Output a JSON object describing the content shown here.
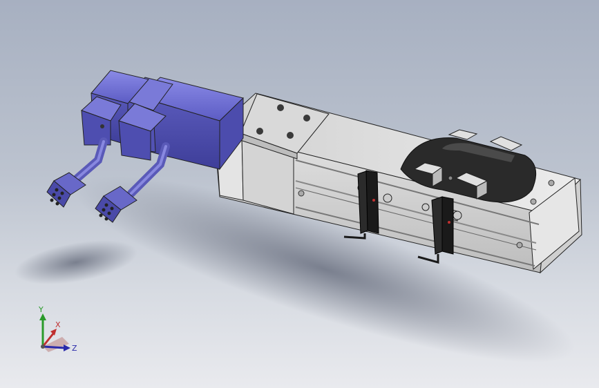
{
  "viewport": {
    "background_top": "#a7b0c1",
    "background_bottom": "#e9eaee"
  },
  "model": {
    "motor_color": "#6767cc",
    "body_color": "#dcdcdc",
    "sensor_color": "#1a1a1a"
  },
  "triad": {
    "x_label": "X",
    "y_label": "Y",
    "z_label": "Z",
    "x_color": "#c03030",
    "y_color": "#2a9a2a",
    "z_color": "#2a2aaa"
  }
}
